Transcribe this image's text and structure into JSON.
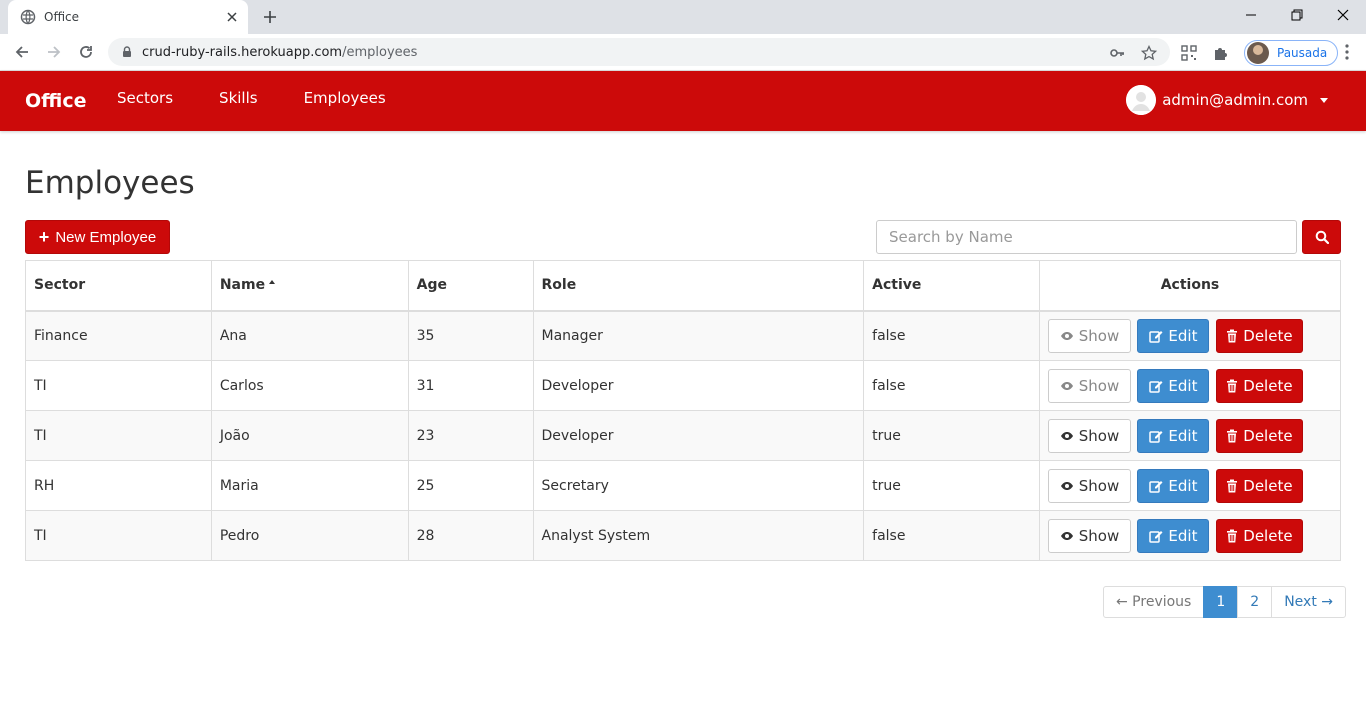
{
  "browser": {
    "tab_title": "Office",
    "url_host": "crud-ruby-rails.herokuapp.com",
    "url_path": "/employees",
    "profile_label": "Pausada"
  },
  "navbar": {
    "brand": "Office",
    "links": [
      "Sectors",
      "Skills",
      "Employees"
    ],
    "user_email": "admin@admin.com",
    "color": "#cc0a0a"
  },
  "page": {
    "title": "Employees",
    "new_button_label": "New Employee",
    "search_placeholder": "Search by Name"
  },
  "table": {
    "headers": {
      "sector": "Sector",
      "name": "Name",
      "age": "Age",
      "role": "Role",
      "active": "Active",
      "actions": "Actions"
    },
    "rows": [
      {
        "sector": "Finance",
        "name": "Ana",
        "age": "35",
        "role": "Manager",
        "active": "false"
      },
      {
        "sector": "TI",
        "name": "Carlos",
        "age": "31",
        "role": "Developer",
        "active": "false"
      },
      {
        "sector": "TI",
        "name": "João",
        "age": "23",
        "role": "Developer",
        "active": "true"
      },
      {
        "sector": "RH",
        "name": "Maria",
        "age": "25",
        "role": "Secretary",
        "active": "true"
      },
      {
        "sector": "TI",
        "name": "Pedro",
        "age": "28",
        "role": "Analyst System",
        "active": "false"
      }
    ],
    "action_labels": {
      "show": "Show",
      "edit": "Edit",
      "delete": "Delete"
    }
  },
  "pagination": {
    "previous": "← Previous",
    "pages": [
      "1",
      "2"
    ],
    "current": "1",
    "next": "Next →"
  }
}
